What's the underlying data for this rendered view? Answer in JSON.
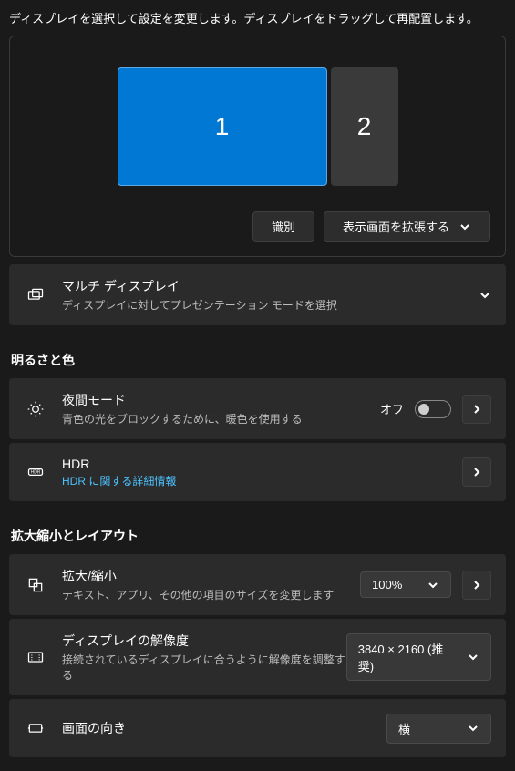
{
  "intro": "ディスプレイを選択して設定を変更します。ディスプレイをドラッグして再配置します。",
  "displays": {
    "primary_label": "1",
    "secondary_label": "2"
  },
  "arrange": {
    "identify_label": "識別",
    "extend_label": "表示画面を拡張する"
  },
  "multi_display": {
    "title": "マルチ ディスプレイ",
    "sub": "ディスプレイに対してプレゼンテーション モードを選択"
  },
  "sections": {
    "brightness_color": "明るさと色",
    "scale_layout": "拡大縮小とレイアウト"
  },
  "night_light": {
    "title": "夜間モード",
    "sub": "青色の光をブロックするために、暖色を使用する",
    "state_label": "オフ"
  },
  "hdr": {
    "title": "HDR",
    "link": "HDR に関する詳細情報"
  },
  "scale": {
    "title": "拡大/縮小",
    "sub": "テキスト、アプリ、その他の項目のサイズを変更します",
    "value": "100%"
  },
  "resolution": {
    "title": "ディスプレイの解像度",
    "sub": "接続されているディスプレイに合うように解像度を調整する",
    "value": "3840 × 2160 (推奨)"
  },
  "orientation": {
    "title": "画面の向き",
    "value": "横"
  }
}
